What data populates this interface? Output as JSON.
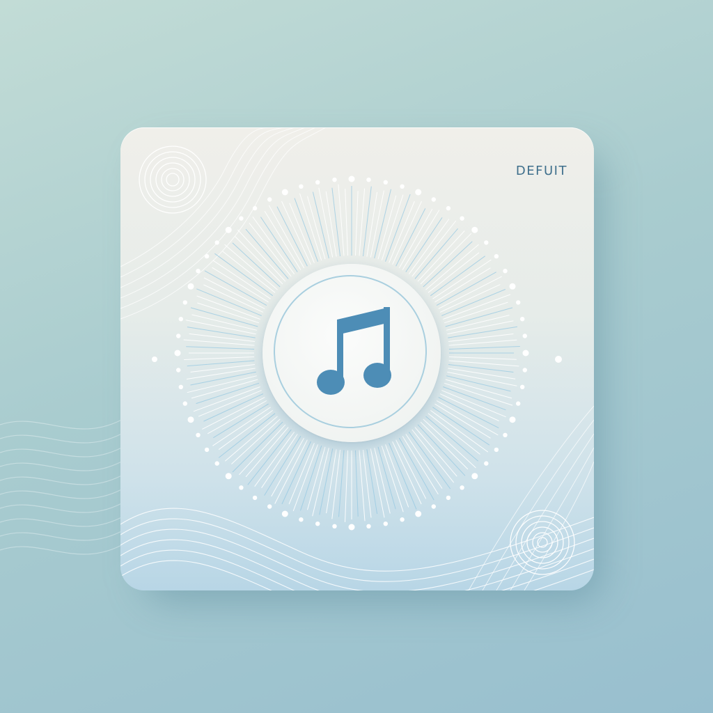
{
  "brand": {
    "label": "DEFUIT"
  },
  "icon": {
    "name": "music-note-icon"
  },
  "colors": {
    "background": "#a9cccf",
    "card_top": "#f0efea",
    "card_bottom": "#b8d6e6",
    "note": "#4d8db6",
    "brand_text": "#3f6f8c",
    "ring": "#a9cfdf"
  }
}
